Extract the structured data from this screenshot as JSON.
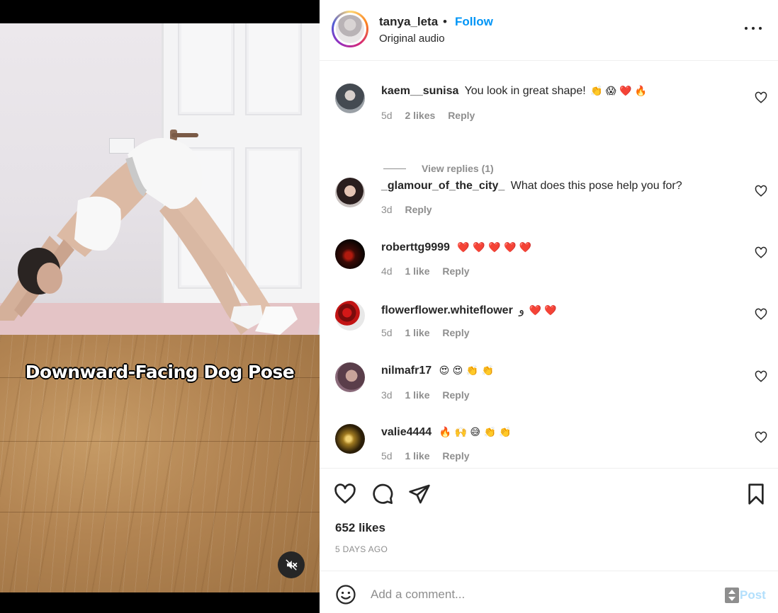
{
  "post": {
    "caption_overlay": "Downward-Facing Dog Pose",
    "mute_icon": "volume-muted-icon"
  },
  "header": {
    "username": "tanya_leta",
    "separator": "•",
    "follow_label": "Follow",
    "audio": "Original audio",
    "more_icon": "more-options-icon"
  },
  "comments": [
    {
      "user": "kaem__sunisa",
      "text": "You look in great shape!",
      "emoji": "👏 😱 ❤️ 🔥",
      "age": "5d",
      "likes": "2 likes",
      "reply": "Reply",
      "avatar_color": "#5a5f66"
    },
    {
      "user": "_glamour_of_the_city_",
      "text": "What does this pose help you for?",
      "emoji": "",
      "age": "3d",
      "likes": "",
      "reply": "Reply",
      "avatar_color": "#3a2a2a"
    },
    {
      "user": "roberttg9999",
      "text": "",
      "emoji": "❤️ ❤️ ❤️ ❤️ ❤️",
      "age": "4d",
      "likes": "1 like",
      "reply": "Reply",
      "avatar_color": "#1a0806"
    },
    {
      "user": "flowerflower.whiteflower",
      "text": "و",
      "emoji": "❤️ ❤️",
      "age": "5d",
      "likes": "1 like",
      "reply": "Reply",
      "avatar_color": "#8c1010"
    },
    {
      "user": "nilmafr17",
      "text": "",
      "emoji": "😍 😍 👏 👏",
      "age": "3d",
      "likes": "1 like",
      "reply": "Reply",
      "avatar_color": "#6b4a5b"
    },
    {
      "user": "valie4444",
      "text": "",
      "emoji": "🔥 🙌 😅 👏 👏",
      "age": "5d",
      "likes": "1 like",
      "reply": "Reply",
      "avatar_color": "#3b2b0f"
    }
  ],
  "view_replies": "View replies (1)",
  "actions": {
    "like_icon": "heart-icon",
    "comment_icon": "comment-icon",
    "share_icon": "send-icon",
    "save_icon": "bookmark-icon",
    "likes": "652 likes",
    "date": "5 DAYS AGO"
  },
  "add_comment": {
    "emoji_icon": "smiley-icon",
    "placeholder": "Add a comment...",
    "post_label": "Post"
  },
  "colors": {
    "accent": "#0095f6",
    "post_disabled": "#b2dffc",
    "heart_red": "#ff3040",
    "muted_text": "#8e8e8e"
  }
}
